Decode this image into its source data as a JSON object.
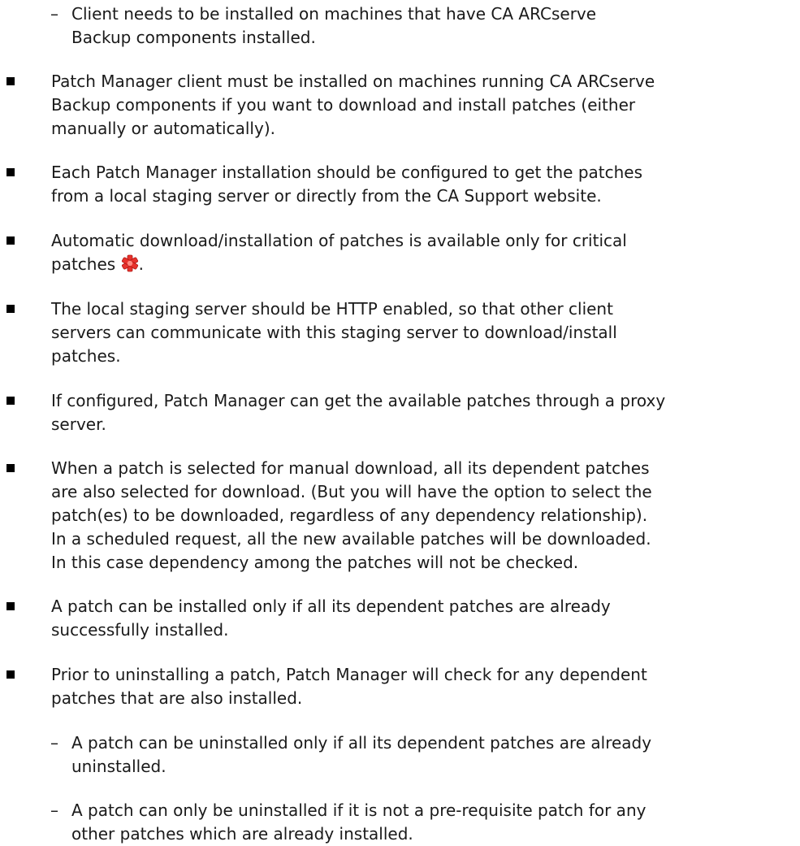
{
  "document": {
    "items": [
      {
        "level": "sub",
        "marker": "–",
        "lines": [
          "Client needs to be installed on machines that have CA ARCserve",
          "Backup components installed."
        ]
      },
      {
        "level": "main",
        "lines": [
          "Patch Manager client must be installed on machines running CA ARCserve",
          "Backup components if you want to download and install patches (either",
          "manually or automatically)."
        ]
      },
      {
        "level": "main",
        "lines": [
          "Each Patch Manager installation should be configured to get the patches",
          "from a local staging server or directly from the CA Support website."
        ]
      },
      {
        "level": "main",
        "lines": [
          "Automatic download/installation of patches is available only for critical",
          "patches"
        ],
        "trailing": ".",
        "icon": "critical-patch-icon",
        "icon_color": "#e8322c"
      },
      {
        "level": "main",
        "lines": [
          "The local staging server should be HTTP enabled, so that other client",
          "servers can communicate with this staging server to download/install",
          "patches."
        ]
      },
      {
        "level": "main",
        "lines": [
          "If configured, Patch Manager can get the available patches through a proxy",
          "server."
        ]
      },
      {
        "level": "main",
        "lines": [
          "When a patch is selected for manual download, all its dependent patches",
          "are also selected for download. (But you will have the option to select the",
          "patch(es) to be downloaded, regardless of any dependency relationship).",
          "In a scheduled request, all the new available patches will be downloaded.",
          "In this case dependency among the patches will not be checked."
        ]
      },
      {
        "level": "main",
        "lines": [
          "A patch can be installed only if all its dependent patches are already",
          "successfully installed."
        ]
      },
      {
        "level": "main",
        "lines": [
          "Prior to uninstalling a patch, Patch Manager will check for any dependent",
          "patches that are also installed."
        ]
      },
      {
        "level": "sub",
        "marker": "–",
        "lines": [
          "A patch can be uninstalled only if all its dependent patches are already",
          "uninstalled."
        ]
      },
      {
        "level": "sub",
        "marker": "–",
        "lines": [
          "A patch can only be uninstalled if it is not a pre-requisite patch for any",
          "other patches which are already installed."
        ]
      }
    ]
  }
}
